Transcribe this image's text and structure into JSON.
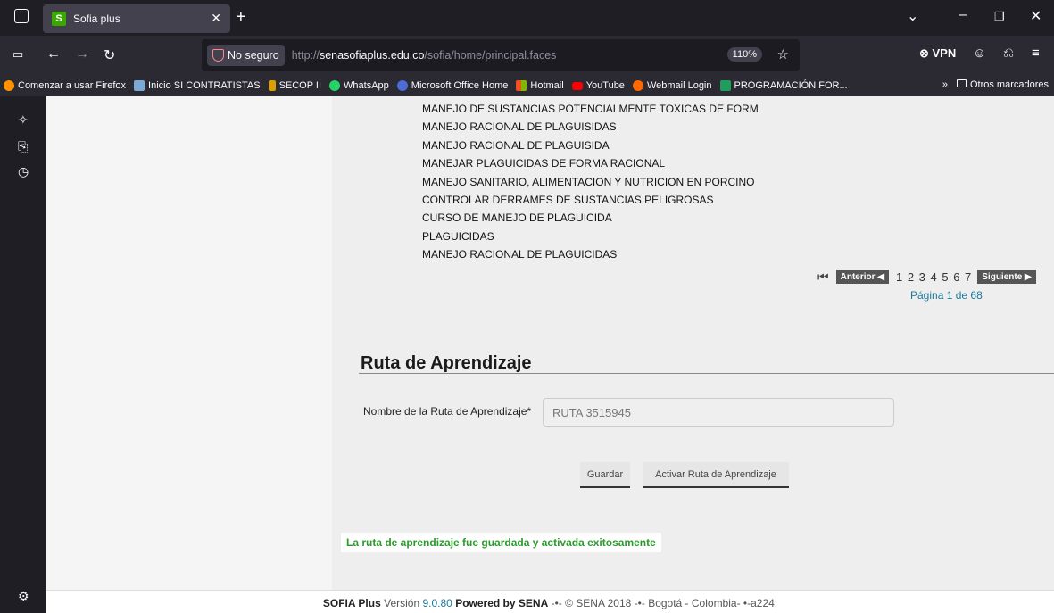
{
  "browser": {
    "tab_title": "Sofia plus",
    "tab_favicon": "S",
    "security_label": "No seguro",
    "url_prefix": "http://",
    "url_host": "senasofiaplus.edu.co",
    "url_path": "/sofia/home/principal.faces",
    "zoom": "110%",
    "vpn_label": "VPN"
  },
  "bookmarks": {
    "items": [
      {
        "label": "Comenzar a usar Firefox",
        "color": "#ff9400"
      },
      {
        "label": "Inicio SI CONTRATISTAS",
        "color": "#7aa9d6"
      },
      {
        "label": "SECOP II",
        "color": "#d9a000"
      },
      {
        "label": "WhatsApp",
        "color": "#25d366"
      },
      {
        "label": "Microsoft Office Home",
        "color": "#4b6bd6"
      },
      {
        "label": "Hotmail",
        "color": "#f25022"
      },
      {
        "label": "YouTube",
        "color": "#ff0000"
      },
      {
        "label": "Webmail Login",
        "color": "#ff6a00"
      },
      {
        "label": "PROGRAMACIÓN FOR...",
        "color": "#1e9e5a"
      }
    ],
    "overflow": "»",
    "other": "Otros marcadores"
  },
  "results": {
    "items": [
      "MANEJO DE SUSTANCIAS POTENCIALMENTE TOXICAS DE FORM",
      "MANEJO RACIONAL DE PLAGUISIDAS",
      "MANEJO RACIONAL DE PLAGUISIDA",
      "MANEJAR PLAGUICIDAS DE FORMA RACIONAL",
      "MANEJO SANITARIO, ALIMENTACION Y NUTRICION EN PORCINO",
      "CONTROLAR DERRAMES DE SUSTANCIAS PELIGROSAS",
      "CURSO DE MANEJO DE PLAGUICIDA",
      "PLAGUICIDAS",
      "MANEJO RACIONAL DE PLAGUICIDAS"
    ]
  },
  "pager": {
    "prev_label": "Anterior",
    "pages": "1 2 3 4 5 6 7",
    "next_label": "Siguiente",
    "info": "Página 1 de 68"
  },
  "form": {
    "section_title": "Ruta de Aprendizaje",
    "name_label": "Nombre de la Ruta de Aprendizaje*",
    "name_value": "RUTA 3515945",
    "save_button": "Guardar",
    "activate_button": "Activar Ruta de Aprendizaje",
    "success_message": "La ruta de aprendizaje fue guardada y activada exitosamente"
  },
  "footer": {
    "brand": "SOFIA Plus",
    "version_label": "Versión",
    "version": "9.0.80",
    "powered": "Powered by SENA",
    "rest": "-•- © SENA 2018 -•- Bogotá - Colombia- •-a224;"
  }
}
